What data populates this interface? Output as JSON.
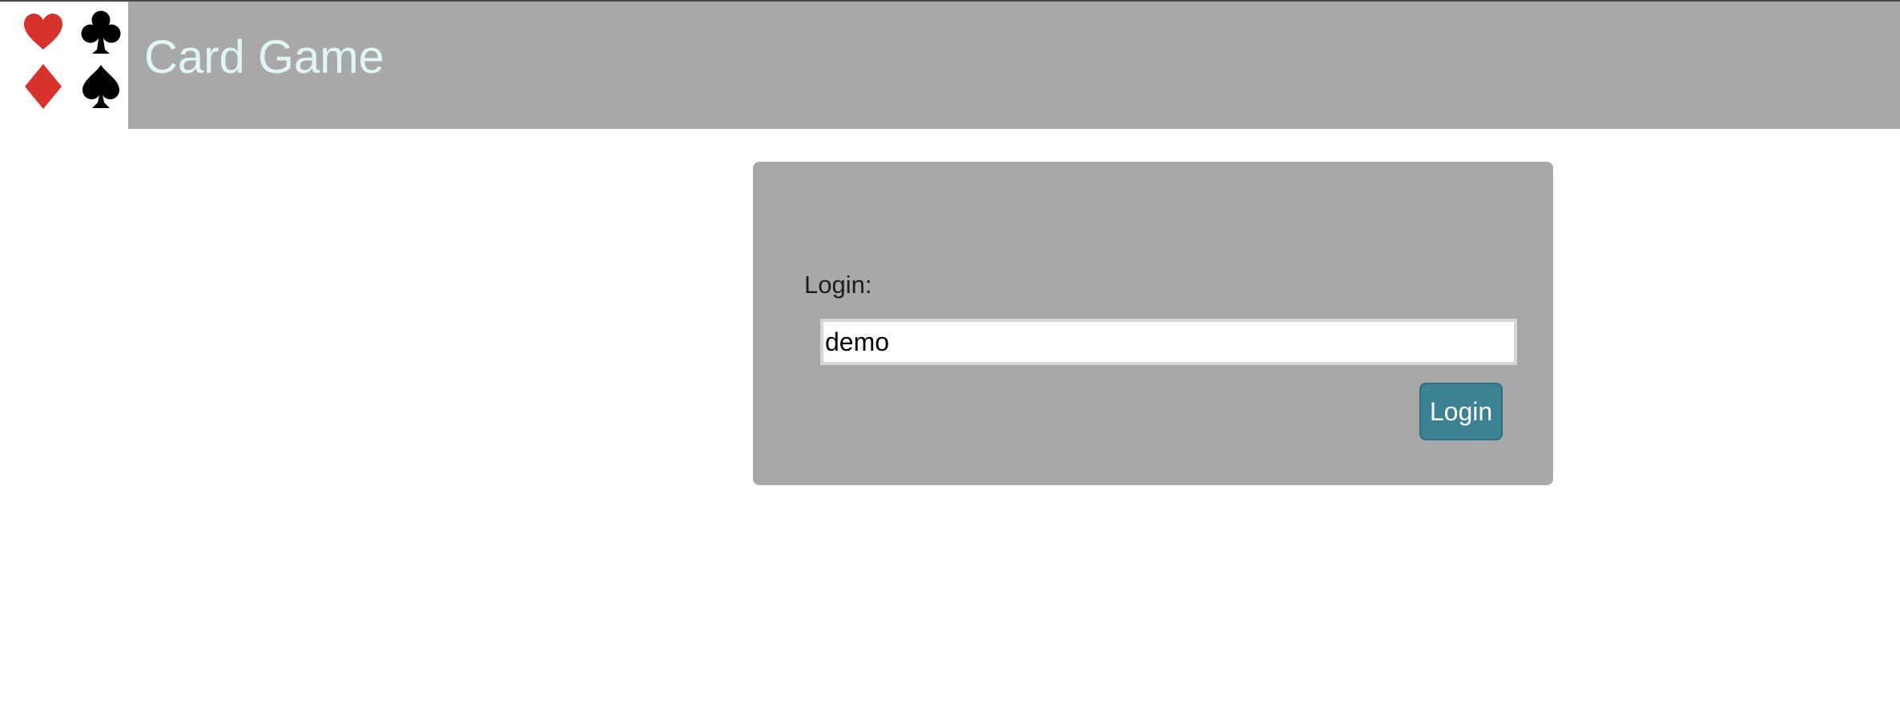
{
  "header": {
    "title": "Card Game",
    "logo": {
      "suits": [
        {
          "icon": "heart-icon",
          "color": "#d7322b"
        },
        {
          "icon": "club-icon",
          "color": "#000000"
        },
        {
          "icon": "diamond-icon",
          "color": "#d7322b"
        },
        {
          "icon": "spade-icon",
          "color": "#000000"
        }
      ]
    },
    "background_color": "#a8a8a8",
    "title_color": "#e0f6f6"
  },
  "login_panel": {
    "label": "Login:",
    "input_value": "demo",
    "button_label": "Login",
    "button_color": "#3a8294",
    "panel_color": "#a8a8a8"
  }
}
